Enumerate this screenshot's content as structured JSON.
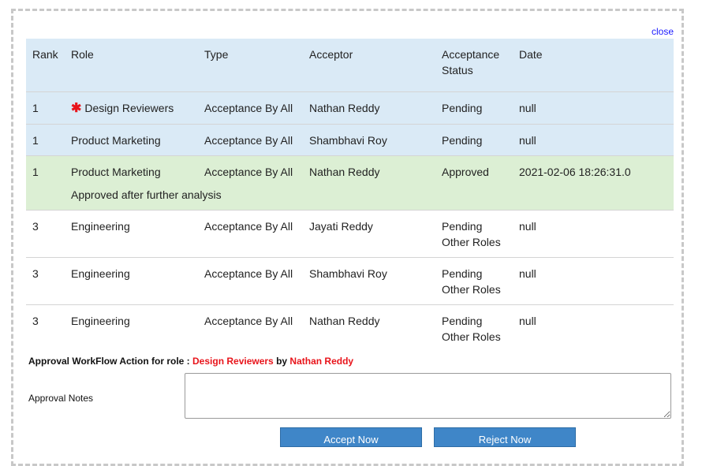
{
  "dialog": {
    "close_label": "close"
  },
  "table": {
    "headers": {
      "rank": "Rank",
      "role": "Role",
      "type": "Type",
      "acceptor": "Acceptor",
      "status_line1": "Acceptance",
      "status_line2": "Status",
      "date": "Date"
    },
    "rows": [
      {
        "rank": "1",
        "role": "Design Reviewers",
        "type": "Acceptance By All",
        "acceptor": "Nathan Reddy",
        "status": "Pending",
        "status2": "",
        "date": "null"
      },
      {
        "rank": "1",
        "role": "Product Marketing",
        "type": "Acceptance By All",
        "acceptor": "Shambhavi Roy",
        "status": "Pending",
        "status2": "",
        "date": "null"
      },
      {
        "rank": "1",
        "role": "Product Marketing",
        "type": "Acceptance By All",
        "acceptor": "Nathan Reddy",
        "status": "Approved",
        "status2": "",
        "date": "2021-02-06 18:26:31.0",
        "remark": "Approved after further analysis"
      },
      {
        "rank": "3",
        "role": "Engineering",
        "type": "Acceptance By All",
        "acceptor": "Jayati Reddy",
        "status": "Pending",
        "status2": "Other Roles",
        "date": "null"
      },
      {
        "rank": "3",
        "role": "Engineering",
        "type": "Acceptance By All",
        "acceptor": "Shambhavi Roy",
        "status": "Pending",
        "status2": "Other Roles",
        "date": "null"
      },
      {
        "rank": "3",
        "role": "Engineering",
        "type": "Acceptance By All",
        "acceptor": "Nathan Reddy",
        "status": "Pending",
        "status2": "Other Roles",
        "date": "null"
      }
    ],
    "required_icon": "asterisk-icon"
  },
  "action": {
    "prefix": "Approval WorkFlow Action for role : ",
    "role": "Design Reviewers",
    "by": " by ",
    "user": "Nathan Reddy"
  },
  "notes": {
    "label": "Approval Notes",
    "value": ""
  },
  "buttons": {
    "accept": "Accept Now",
    "reject": "Reject Now"
  },
  "colors": {
    "pending_row_bg": "#daeaf6",
    "approved_row_bg": "#dcefd4",
    "accent_red": "#e8141b",
    "button_blue": "#3f86c8"
  }
}
